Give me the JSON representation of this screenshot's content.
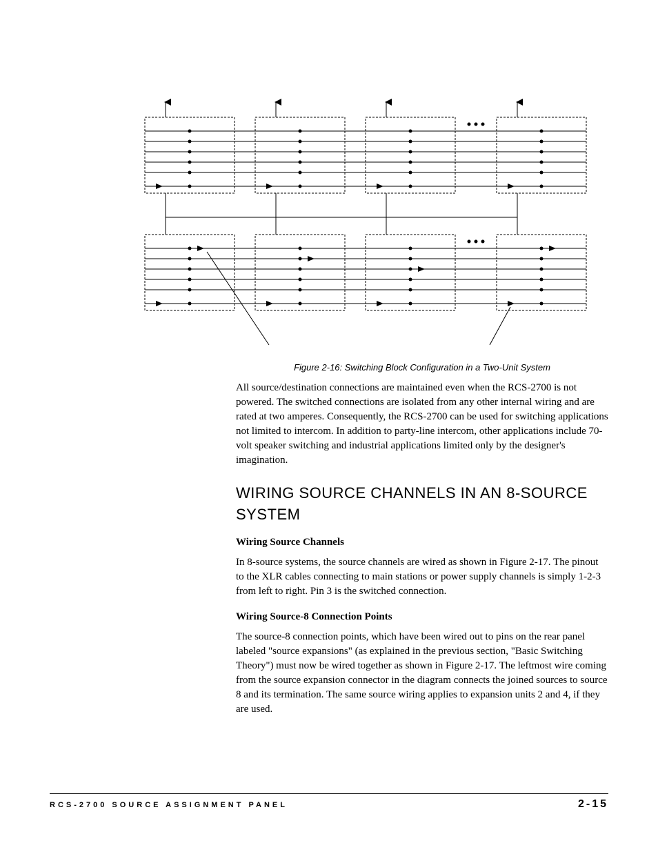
{
  "figure": {
    "caption": "Figure 2-16: Switching Block Configuration in a Two-Unit System"
  },
  "paragraphs": {
    "p1": "All source/destination connections are maintained even when the RCS-2700 is not powered. The switched connections are isolated from any other internal wiring and are rated at two amperes. Consequently, the RCS-2700 can be used for switching applications not limited to intercom. In addition to party-line intercom, other applications include 70-volt speaker switching and industrial applications limited only by the designer's imagination."
  },
  "headings": {
    "h2_1": "WIRING SOURCE CHANNELS IN AN 8-SOURCE SYSTEM",
    "h3_1": "Wiring Source Channels",
    "h3_2": "Wiring Source-8 Connection Points"
  },
  "section1": {
    "p1": "In 8-source systems, the source channels are wired as shown in Figure 2-17. The pinout to the XLR cables connecting to main stations or power supply channels is simply 1-2-3 from left to right. Pin 3 is the switched connection."
  },
  "section2": {
    "p1": "The source-8 connection points, which have been wired out to pins on the rear panel labeled \"source expansions\" (as explained in the previous section, \"Basic Switching Theory\") must now be wired together as shown in Figure 2-17. The leftmost wire coming from the source expansion connector in the diagram connects the joined sources to source 8 and its termination. The same source wiring applies to expansion units 2 and 4, if they are used."
  },
  "footer": {
    "left": "RCS-2700 SOURCE ASSIGNMENT PANEL",
    "right": "2-15"
  }
}
